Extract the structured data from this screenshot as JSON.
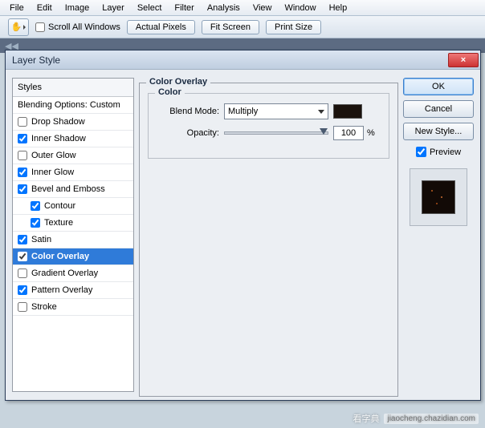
{
  "menu": [
    "File",
    "Edit",
    "Image",
    "Layer",
    "Select",
    "Filter",
    "Analysis",
    "View",
    "Window",
    "Help"
  ],
  "toolbar": {
    "scroll_label": "Scroll All Windows",
    "buttons": [
      "Actual Pixels",
      "Fit Screen",
      "Print Size"
    ]
  },
  "dialog": {
    "title": "Layer Style",
    "close": "×"
  },
  "styles": {
    "header": "Styles",
    "blending": "Blending Options: Custom",
    "items": [
      {
        "label": "Drop Shadow",
        "checked": false,
        "indent": false
      },
      {
        "label": "Inner Shadow",
        "checked": true,
        "indent": false
      },
      {
        "label": "Outer Glow",
        "checked": false,
        "indent": false
      },
      {
        "label": "Inner Glow",
        "checked": true,
        "indent": false
      },
      {
        "label": "Bevel and Emboss",
        "checked": true,
        "indent": false
      },
      {
        "label": "Contour",
        "checked": true,
        "indent": true
      },
      {
        "label": "Texture",
        "checked": true,
        "indent": true
      },
      {
        "label": "Satin",
        "checked": true,
        "indent": false
      },
      {
        "label": "Color Overlay",
        "checked": true,
        "indent": false,
        "selected": true
      },
      {
        "label": "Gradient Overlay",
        "checked": false,
        "indent": false
      },
      {
        "label": "Pattern Overlay",
        "checked": true,
        "indent": false
      },
      {
        "label": "Stroke",
        "checked": false,
        "indent": false
      }
    ]
  },
  "center": {
    "group_title": "Color Overlay",
    "inner_title": "Color",
    "blend_label": "Blend Mode:",
    "blend_value": "Multiply",
    "opacity_label": "Opacity:",
    "opacity_value": "100",
    "opacity_unit": "%"
  },
  "right": {
    "ok": "OK",
    "cancel": "Cancel",
    "new_style": "New Style...",
    "preview": "Preview"
  },
  "watermark": {
    "primary": "看字典",
    "secondary": "jiaocheng.chazidian.com"
  }
}
